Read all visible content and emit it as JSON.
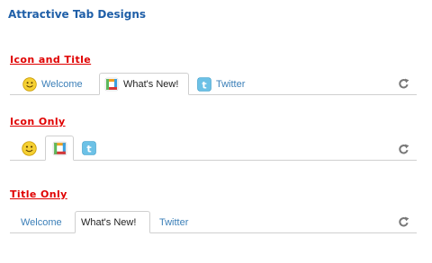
{
  "page_title": "Attractive Tab Designs",
  "sections": [
    {
      "label": "Icon and Title",
      "tabs": [
        {
          "label": "Welcome",
          "icon": "smiley-icon",
          "active": false
        },
        {
          "label": "What's New!",
          "icon": "colorful-square-icon",
          "active": true
        },
        {
          "label": "Twitter",
          "icon": "twitter-icon",
          "active": false
        }
      ]
    },
    {
      "label": "Icon Only",
      "tabs": [
        {
          "icon": "smiley-icon",
          "active": false
        },
        {
          "icon": "colorful-square-icon",
          "active": true
        },
        {
          "icon": "twitter-icon",
          "active": false
        }
      ]
    },
    {
      "label": "Title Only",
      "tabs": [
        {
          "label": "Welcome",
          "active": false
        },
        {
          "label": "What's New!",
          "active": true
        },
        {
          "label": "Twitter",
          "active": false
        }
      ]
    }
  ],
  "refresh_icon": "refresh-icon",
  "colors": {
    "title": "#1f5fa8",
    "section_label": "#e00000",
    "tab_text": "#3b7fb8",
    "active_tab_text": "#222222",
    "border": "#cfcfcf"
  }
}
